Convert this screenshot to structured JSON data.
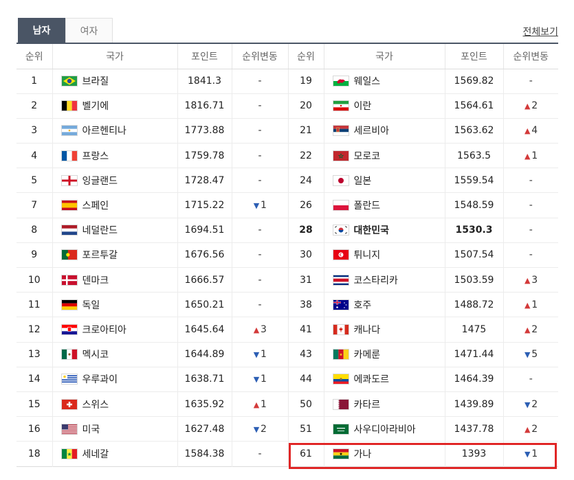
{
  "tabs": [
    {
      "label": "남자",
      "active": true
    },
    {
      "label": "여자",
      "active": false
    }
  ],
  "view_all": "전체보기",
  "headers": [
    "순위",
    "국가",
    "포인트",
    "순위변동",
    "순위",
    "국가",
    "포인트",
    "순위변동"
  ],
  "rows": [
    {
      "left": {
        "rank": "1",
        "flag": "brazil-flag",
        "country": "브라질",
        "points": "1841.3",
        "change": {
          "dir": "none",
          "value": "-"
        }
      },
      "right": {
        "rank": "19",
        "flag": "wales-flag",
        "country": "웨일스",
        "points": "1569.82",
        "change": {
          "dir": "none",
          "value": "-"
        }
      }
    },
    {
      "left": {
        "rank": "2",
        "flag": "belgium-flag",
        "country": "벨기에",
        "points": "1816.71",
        "change": {
          "dir": "none",
          "value": "-"
        }
      },
      "right": {
        "rank": "20",
        "flag": "iran-flag",
        "country": "이란",
        "points": "1564.61",
        "change": {
          "dir": "up",
          "value": "2"
        }
      }
    },
    {
      "left": {
        "rank": "3",
        "flag": "argentina-flag",
        "country": "아르헨티나",
        "points": "1773.88",
        "change": {
          "dir": "none",
          "value": "-"
        }
      },
      "right": {
        "rank": "21",
        "flag": "serbia-flag",
        "country": "세르비아",
        "points": "1563.62",
        "change": {
          "dir": "up",
          "value": "4"
        }
      }
    },
    {
      "left": {
        "rank": "4",
        "flag": "france-flag",
        "country": "프랑스",
        "points": "1759.78",
        "change": {
          "dir": "none",
          "value": "-"
        }
      },
      "right": {
        "rank": "22",
        "flag": "morocco-flag",
        "country": "모로코",
        "points": "1563.5",
        "change": {
          "dir": "up",
          "value": "1"
        }
      }
    },
    {
      "left": {
        "rank": "5",
        "flag": "england-flag",
        "country": "잉글랜드",
        "points": "1728.47",
        "change": {
          "dir": "none",
          "value": "-"
        }
      },
      "right": {
        "rank": "24",
        "flag": "japan-flag",
        "country": "일본",
        "points": "1559.54",
        "change": {
          "dir": "none",
          "value": "-"
        }
      }
    },
    {
      "left": {
        "rank": "7",
        "flag": "spain-flag",
        "country": "스페인",
        "points": "1715.22",
        "change": {
          "dir": "down",
          "value": "1"
        }
      },
      "right": {
        "rank": "26",
        "flag": "poland-flag",
        "country": "폴란드",
        "points": "1548.59",
        "change": {
          "dir": "none",
          "value": "-"
        }
      }
    },
    {
      "left": {
        "rank": "8",
        "flag": "netherlands-flag",
        "country": "네덜란드",
        "points": "1694.51",
        "change": {
          "dir": "none",
          "value": "-"
        }
      },
      "right": {
        "rank": "28",
        "flag": "korea-flag",
        "country": "대한민국",
        "points": "1530.3",
        "change": {
          "dir": "none",
          "value": "-"
        },
        "bold": true
      }
    },
    {
      "left": {
        "rank": "9",
        "flag": "portugal-flag",
        "country": "포르투갈",
        "points": "1676.56",
        "change": {
          "dir": "none",
          "value": "-"
        }
      },
      "right": {
        "rank": "30",
        "flag": "tunisia-flag",
        "country": "튀니지",
        "points": "1507.54",
        "change": {
          "dir": "none",
          "value": "-"
        }
      }
    },
    {
      "left": {
        "rank": "10",
        "flag": "denmark-flag",
        "country": "덴마크",
        "points": "1666.57",
        "change": {
          "dir": "none",
          "value": "-"
        }
      },
      "right": {
        "rank": "31",
        "flag": "costa-rica-flag",
        "country": "코스타리카",
        "points": "1503.59",
        "change": {
          "dir": "up",
          "value": "3"
        }
      }
    },
    {
      "left": {
        "rank": "11",
        "flag": "germany-flag",
        "country": "독일",
        "points": "1650.21",
        "change": {
          "dir": "none",
          "value": "-"
        }
      },
      "right": {
        "rank": "38",
        "flag": "australia-flag",
        "country": "호주",
        "points": "1488.72",
        "change": {
          "dir": "up",
          "value": "1"
        }
      }
    },
    {
      "left": {
        "rank": "12",
        "flag": "croatia-flag",
        "country": "크로아티아",
        "points": "1645.64",
        "change": {
          "dir": "up",
          "value": "3"
        }
      },
      "right": {
        "rank": "41",
        "flag": "canada-flag",
        "country": "캐나다",
        "points": "1475",
        "change": {
          "dir": "up",
          "value": "2"
        }
      }
    },
    {
      "left": {
        "rank": "13",
        "flag": "mexico-flag",
        "country": "멕시코",
        "points": "1644.89",
        "change": {
          "dir": "down",
          "value": "1"
        }
      },
      "right": {
        "rank": "43",
        "flag": "cameroon-flag",
        "country": "카메룬",
        "points": "1471.44",
        "change": {
          "dir": "down",
          "value": "5"
        }
      }
    },
    {
      "left": {
        "rank": "14",
        "flag": "uruguay-flag",
        "country": "우루과이",
        "points": "1638.71",
        "change": {
          "dir": "down",
          "value": "1"
        }
      },
      "right": {
        "rank": "44",
        "flag": "ecuador-flag",
        "country": "에콰도르",
        "points": "1464.39",
        "change": {
          "dir": "none",
          "value": "-"
        }
      }
    },
    {
      "left": {
        "rank": "15",
        "flag": "switzerland-flag",
        "country": "스위스",
        "points": "1635.92",
        "change": {
          "dir": "up",
          "value": "1"
        }
      },
      "right": {
        "rank": "50",
        "flag": "qatar-flag",
        "country": "카타르",
        "points": "1439.89",
        "change": {
          "dir": "down",
          "value": "2"
        }
      }
    },
    {
      "left": {
        "rank": "16",
        "flag": "usa-flag",
        "country": "미국",
        "points": "1627.48",
        "change": {
          "dir": "down",
          "value": "2"
        }
      },
      "right": {
        "rank": "51",
        "flag": "saudi-arabia-flag",
        "country": "사우디아라비아",
        "points": "1437.78",
        "change": {
          "dir": "up",
          "value": "2"
        }
      }
    },
    {
      "left": {
        "rank": "18",
        "flag": "senegal-flag",
        "country": "세네갈",
        "points": "1584.38",
        "change": {
          "dir": "none",
          "value": "-"
        }
      },
      "right": {
        "rank": "61",
        "flag": "ghana-flag",
        "country": "가나",
        "points": "1393",
        "change": {
          "dir": "down",
          "value": "1"
        }
      }
    }
  ],
  "colors": {
    "header_bar": "#4a5565",
    "up": "#d33a3a",
    "down": "#2d5fb4",
    "highlight": "#e02525"
  }
}
